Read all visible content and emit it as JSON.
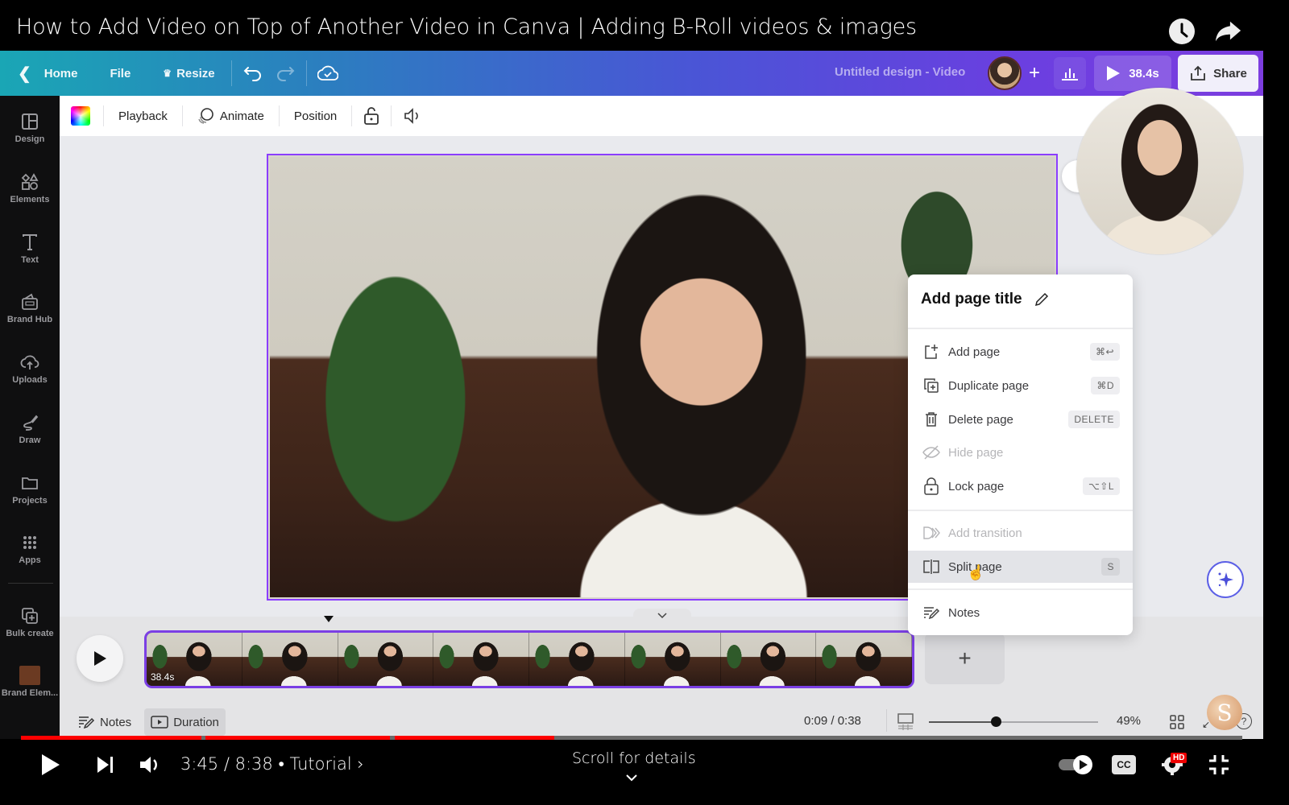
{
  "youtube": {
    "video_title": "How to Add Video on Top of Another Video in Canva | Adding B-Roll videos & images",
    "top_icons": [
      "watch-later-icon",
      "share-icon"
    ],
    "current_time": "3:45",
    "total_time": "8:38",
    "time_display": "3:45 / 8:38",
    "chapter": "• Tutorial ›",
    "scroll_hint": "Scroll for details",
    "progress_fraction": 0.43,
    "chapter_segments_played": [
      [
        0,
        0.148
      ],
      [
        0.151,
        0.302
      ],
      [
        0.306,
        0.437
      ]
    ],
    "hd_badge": "HD",
    "cc_label": "CC",
    "colors": {
      "progress": "#ff0000",
      "hd_badge": "#ee0000"
    }
  },
  "canva": {
    "topbar": {
      "home": "Home",
      "file": "File",
      "resize": "Resize",
      "design_title": "Untitled design - Video",
      "present_duration": "38.4s",
      "share": "Share"
    },
    "sidebar": {
      "items": [
        {
          "label": "Design",
          "icon": "layout-icon"
        },
        {
          "label": "Elements",
          "icon": "shapes-icon"
        },
        {
          "label": "Text",
          "icon": "text-icon"
        },
        {
          "label": "Brand Hub",
          "icon": "brand-hub-icon"
        },
        {
          "label": "Uploads",
          "icon": "cloud-upload-icon"
        },
        {
          "label": "Draw",
          "icon": "draw-icon"
        },
        {
          "label": "Projects",
          "icon": "folder-icon"
        },
        {
          "label": "Apps",
          "icon": "apps-grid-icon"
        },
        {
          "label": "Bulk create",
          "icon": "bulk-create-icon"
        },
        {
          "label": "Brand Elem...",
          "icon": "brand-swatch"
        }
      ]
    },
    "context_toolbar": {
      "playback": "Playback",
      "animate": "Animate",
      "position": "Position"
    },
    "page_menu": {
      "title": "Add page title",
      "items": [
        {
          "label": "Add page",
          "shortcut": "⌘↩",
          "disabled": false
        },
        {
          "label": "Duplicate page",
          "shortcut": "⌘D",
          "disabled": false
        },
        {
          "label": "Delete page",
          "shortcut": "DELETE",
          "disabled": false
        },
        {
          "label": "Hide page",
          "shortcut": "",
          "disabled": true
        },
        {
          "label": "Lock page",
          "shortcut": "⌥⇧L",
          "disabled": false
        },
        {
          "label": "Add transition",
          "shortcut": "",
          "disabled": true
        },
        {
          "label": "Split page",
          "shortcut": "S",
          "disabled": false,
          "hovered": true
        },
        {
          "label": "Notes",
          "shortcut": "",
          "disabled": false
        }
      ]
    },
    "timeline": {
      "clip_duration": "38.4s",
      "thumbnail_count": 8,
      "add_page": "+"
    },
    "footer": {
      "notes": "Notes",
      "duration": "Duration",
      "time_readout": "0:09 / 0:38",
      "zoom_percent": "49%",
      "zoom_fraction": 0.38,
      "help": "?"
    },
    "colors": {
      "selection": "#8b3dff",
      "topbar_start": "#1aa6b5",
      "topbar_end": "#7c3ddf",
      "sidebar_bg": "#0f0f10"
    }
  },
  "channel_logo": "S"
}
